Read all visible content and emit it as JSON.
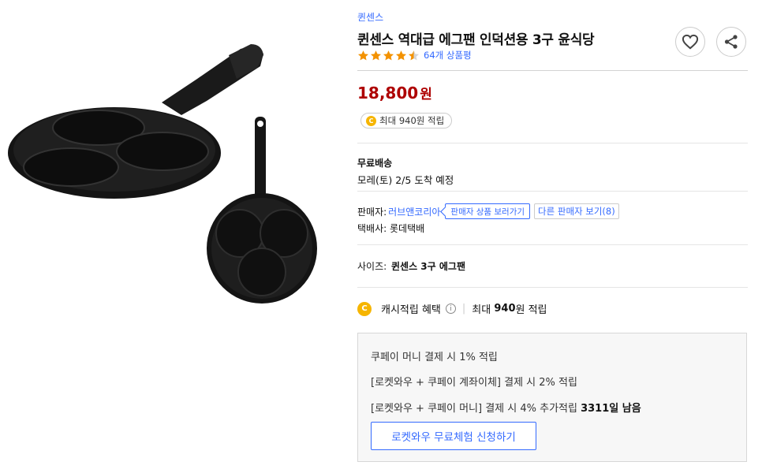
{
  "product": {
    "brand": "퀸센스",
    "title": "퀸센스 역대급 에그팬 인덕션용 3구 윤식당",
    "rating": 4.5,
    "review_count": "64개 상품평",
    "price": "18,800",
    "price_unit": "원",
    "reward_badge": "최대 940원 적립"
  },
  "icons": {
    "heart": "heart-icon",
    "share": "share-icon",
    "coin_symbol": "C"
  },
  "shipping": {
    "label": "무료배송",
    "eta": "모레(토) 2/5 도착 예정"
  },
  "seller": {
    "label": "판매자:",
    "name": "러브앤코리아",
    "products_button": "판매자 상품 보러가기",
    "other_sellers_button": "다른 판매자 보기(8)",
    "courier_label": "택배사:",
    "courier": "롯데택배"
  },
  "option": {
    "label": "사이즈:",
    "value": "퀸센스 3구 에그팬"
  },
  "cash_benefit": {
    "label": "캐시적립 혜택",
    "info_symbol": "i",
    "max_prefix": "최대",
    "max_amount": "940",
    "max_suffix": "원 적립"
  },
  "benefit_box": {
    "line1": "쿠페이 머니 결제 시 1% 적립",
    "line2": "[로켓와우 + 쿠페이 계좌이체] 결제 시 2% 적립",
    "line3_prefix": "[로켓와우 + 쿠페이 머니] 결제 시 4% 추가적립",
    "line3_days": "3311",
    "line3_suffix": "일 남음",
    "trial_button": "로켓와우 무료체험 신청하기"
  },
  "colors": {
    "link_blue": "#346aff",
    "price_red": "#ae0000",
    "star_orange": "#f39200",
    "coin_yellow": "#f6b500"
  }
}
